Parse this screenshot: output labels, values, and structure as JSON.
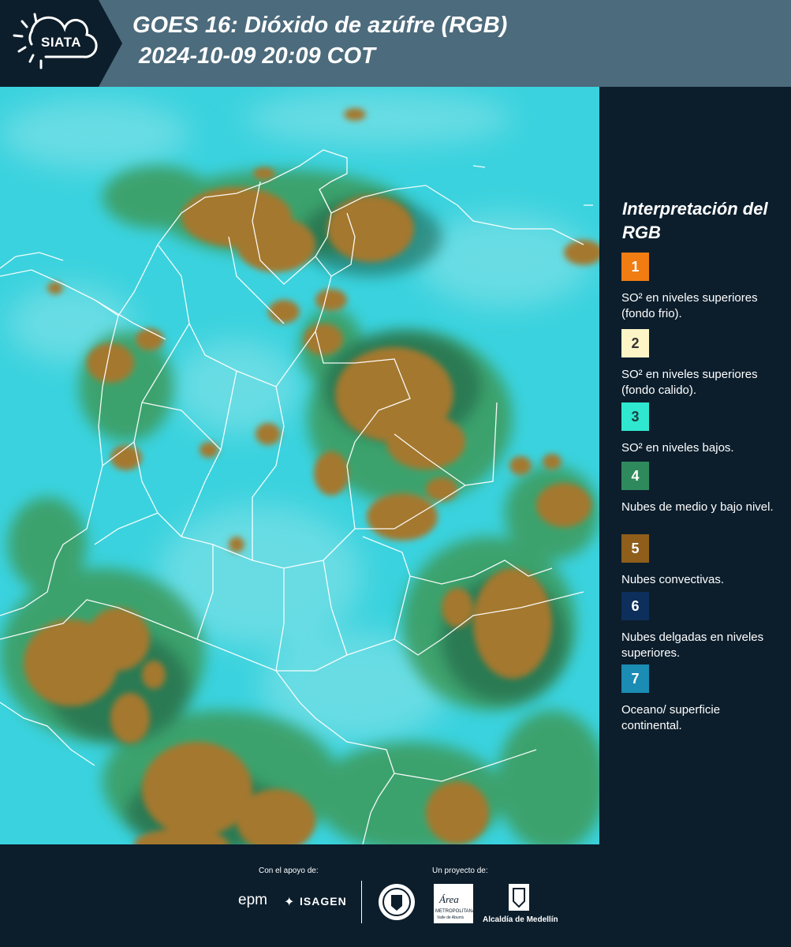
{
  "header": {
    "logo_text": "SIATA",
    "title_line1": "GOES 16: Dióxido de azúfre (RGB)",
    "title_line2": "2024-10-09 20:09 COT"
  },
  "legend": {
    "title": "Interpretación del RGB",
    "items": [
      {
        "number": "1",
        "color": "#f07c12",
        "text_color": "#ffffff",
        "description": "SO² en niveles superiores (fondo frio)."
      },
      {
        "number": "2",
        "color": "#fdf5c6",
        "text_color": "#333333",
        "description": "SO² en niveles superiores (fondo calido)."
      },
      {
        "number": "3",
        "color": "#2fe8cf",
        "text_color": "#1a4040",
        "description": "SO² en niveles bajos."
      },
      {
        "number": "4",
        "color": "#2e8a5c",
        "text_color": "#ffffff",
        "description": "Nubes de medio y bajo nivel."
      },
      {
        "number": "5",
        "color": "#8e5e1a",
        "text_color": "#ffffff",
        "description": "Nubes convectivas."
      },
      {
        "number": "6",
        "color": "#0d2f5b",
        "text_color": "#ffffff",
        "description": "Nubes delgadas en niveles superiores."
      },
      {
        "number": "7",
        "color": "#1b8cb3",
        "text_color": "#ffffff",
        "description": "Oceano/ superficie continental."
      }
    ]
  },
  "footer": {
    "support_label": "Con el apoyo de:",
    "project_label": "Un proyecto de:",
    "sponsor_epm": "epm",
    "sponsor_isagen": "ISAGEN",
    "partner_area": "Área",
    "partner_area_sub": "METROPOLITANA",
    "partner_area_sub2": "Valle de Aburrá",
    "partner_alcaldia": "Alcaldía de Medellín"
  },
  "colors": {
    "header_bg": "#4c6b7c",
    "panel_bg": "#0c1e2c",
    "map_background": "#3ad2de",
    "convective_cloud": "#a4782e",
    "low_cloud": "#3e9a5a"
  }
}
